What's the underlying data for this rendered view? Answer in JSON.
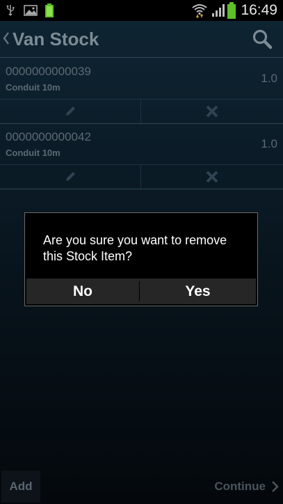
{
  "status_bar": {
    "time": "16:49",
    "icons": [
      "usb-icon",
      "gallery-icon",
      "battery-charge-notification-icon",
      "wifi-icon",
      "signal-icon",
      "battery-icon"
    ]
  },
  "action_bar": {
    "title": "Van Stock",
    "back_icon": "chevron-left-icon",
    "search_icon": "search-icon"
  },
  "stock_items": [
    {
      "code": "0000000000039",
      "name": "Conduit 10m",
      "quantity": "1.0",
      "edit_icon": "pencil-icon",
      "delete_icon": "close-icon"
    },
    {
      "code": "0000000000042",
      "name": "Conduit 10m",
      "quantity": "1.0",
      "edit_icon": "pencil-icon",
      "delete_icon": "close-icon"
    }
  ],
  "dialog": {
    "message": "Are you sure you want to remove this Stock Item?",
    "no_label": "No",
    "yes_label": "Yes"
  },
  "bottom_bar": {
    "add_label": "Add",
    "continue_label": "Continue",
    "continue_icon": "chevron-right-icon"
  },
  "colors": {
    "background_top": "#0f2533",
    "background_bottom": "#04080c",
    "dialog_background": "#000000",
    "dialog_button_bar": "#262626",
    "dimmed_text": "#5c6a73"
  }
}
